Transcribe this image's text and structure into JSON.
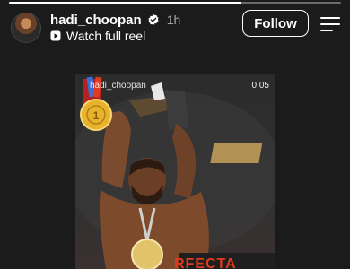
{
  "story": {
    "progress_fraction": 0.7
  },
  "header": {
    "username": "hadi_choopan",
    "time_ago": "1h",
    "reel_link_label": "Watch full reel",
    "follow_label": "Follow",
    "verified_icon": "verified-badge-icon",
    "menu_icon": "menu-icon"
  },
  "video": {
    "watermark": "hadi_choopan",
    "duration": "0:05",
    "banner_text": "RFECTA"
  },
  "colors": {
    "background": "#1b1b1b",
    "verified": "#ffffff",
    "banner": "#e23a1e"
  }
}
